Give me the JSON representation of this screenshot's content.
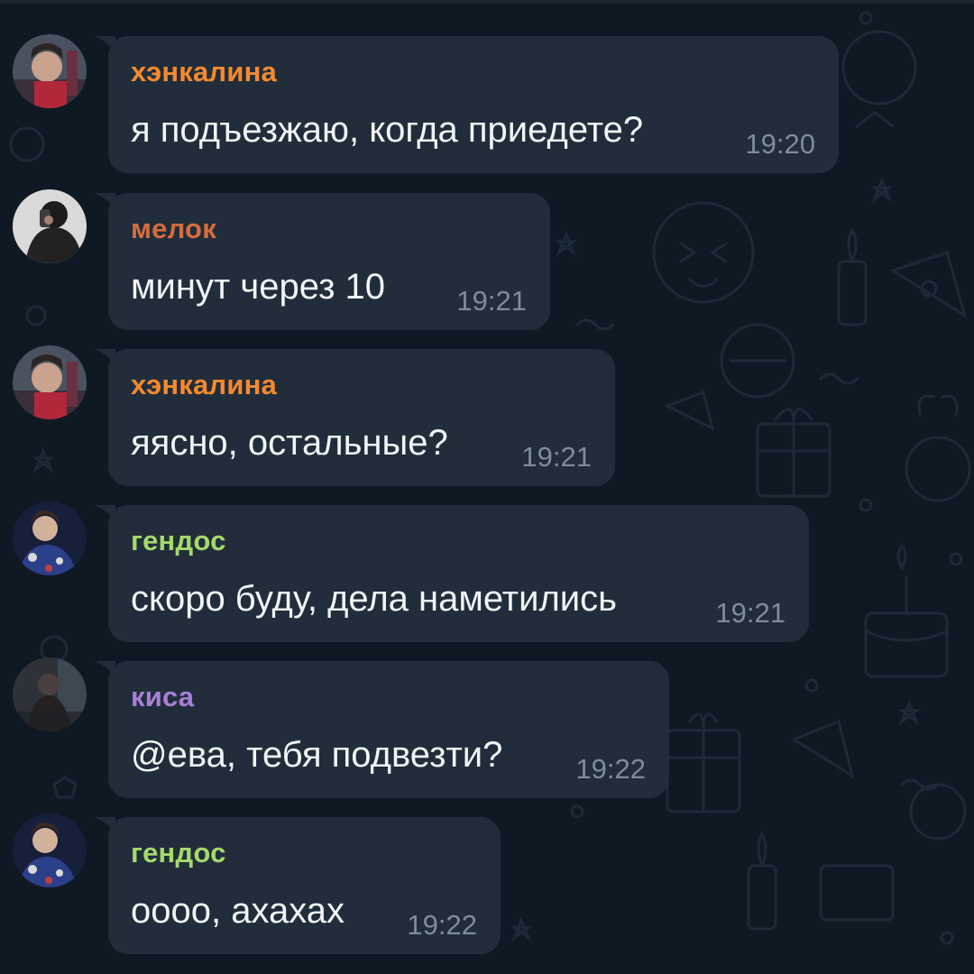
{
  "colors": {
    "background": "#0f1923",
    "bubble": "#212d3b",
    "message_text": "#f1f4f7",
    "timestamp": "#7e8c9b"
  },
  "messages": [
    {
      "sender": "хэнкалина",
      "sender_color": "#f58a2c",
      "text": "я подъезжаю, когда приедете?",
      "time": "19:20",
      "avatar": "avatar-henkalina"
    },
    {
      "sender": "мелок",
      "sender_color": "#d56d3e",
      "text": "минут через 10",
      "time": "19:21",
      "avatar": "avatar-melok"
    },
    {
      "sender": "хэнкалина",
      "sender_color": "#f58a2c",
      "text": "яясно, остальные?",
      "time": "19:21",
      "avatar": "avatar-henkalina"
    },
    {
      "sender": "гендос",
      "sender_color": "#a6d86a",
      "text": "скоро буду, дела наметились",
      "time": "19:21",
      "avatar": "avatar-gendos"
    },
    {
      "sender": "киса",
      "sender_color": "#a77fd6",
      "text": "@ева, тебя подвезти?",
      "time": "19:22",
      "avatar": "avatar-kisa"
    },
    {
      "sender": "гендос",
      "sender_color": "#a6d86a",
      "text": "оооо, ахахах",
      "time": "19:22",
      "avatar": "avatar-gendos"
    }
  ]
}
